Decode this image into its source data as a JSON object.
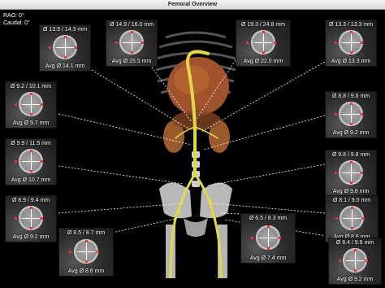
{
  "window": {
    "title": "Femoral Overview"
  },
  "orientation": {
    "rao": "RAO: 0°",
    "caudal": "Caudal: 0°"
  },
  "panels": [
    {
      "top": "Ø 13.9 / 14.3 mm",
      "bottom": "Avg Ø 14.1 mm"
    },
    {
      "top": "Ø 14.9 / 16.0 mm",
      "bottom": "Avg Ø 15.5 mm"
    },
    {
      "top": "Ø 19.3 / 24.8 mm",
      "bottom": "Avg Ø 22.0 mm"
    },
    {
      "top": "Ø 13.3 / 13.3 mm",
      "bottom": "Avg Ø 13.3 mm"
    },
    {
      "top": "Ø 9.2 / 10.1 mm",
      "bottom": "Avg Ø 9.7 mm"
    },
    {
      "top": "Ø 8.8 / 9.6 mm",
      "bottom": "Avg Ø 9.2 mm"
    },
    {
      "top": "Ø 9.9 / 11.5 mm",
      "bottom": "Avg Ø 10.7 mm"
    },
    {
      "top": "Ø 9.8 / 9.8 mm",
      "bottom": "Avg Ø 9.8 mm"
    },
    {
      "top": "Ø 8.9 / 9.4 mm",
      "bottom": "Avg Ø 9.2 mm"
    },
    {
      "top": "Ø 8.1 / 9.0 mm",
      "bottom": "Avg Ø 8.6 mm"
    },
    {
      "top": "Ø 8.5 / 8.7 mm",
      "bottom": "Avg Ø 8.6 mm"
    },
    {
      "top": "Ø 6.5 / 8.3 mm",
      "bottom": "Avg Ø 7.4 mm"
    },
    {
      "top": "Ø 8.4 / 9.9 mm",
      "bottom": "Avg Ø 9.2 mm"
    }
  ]
}
